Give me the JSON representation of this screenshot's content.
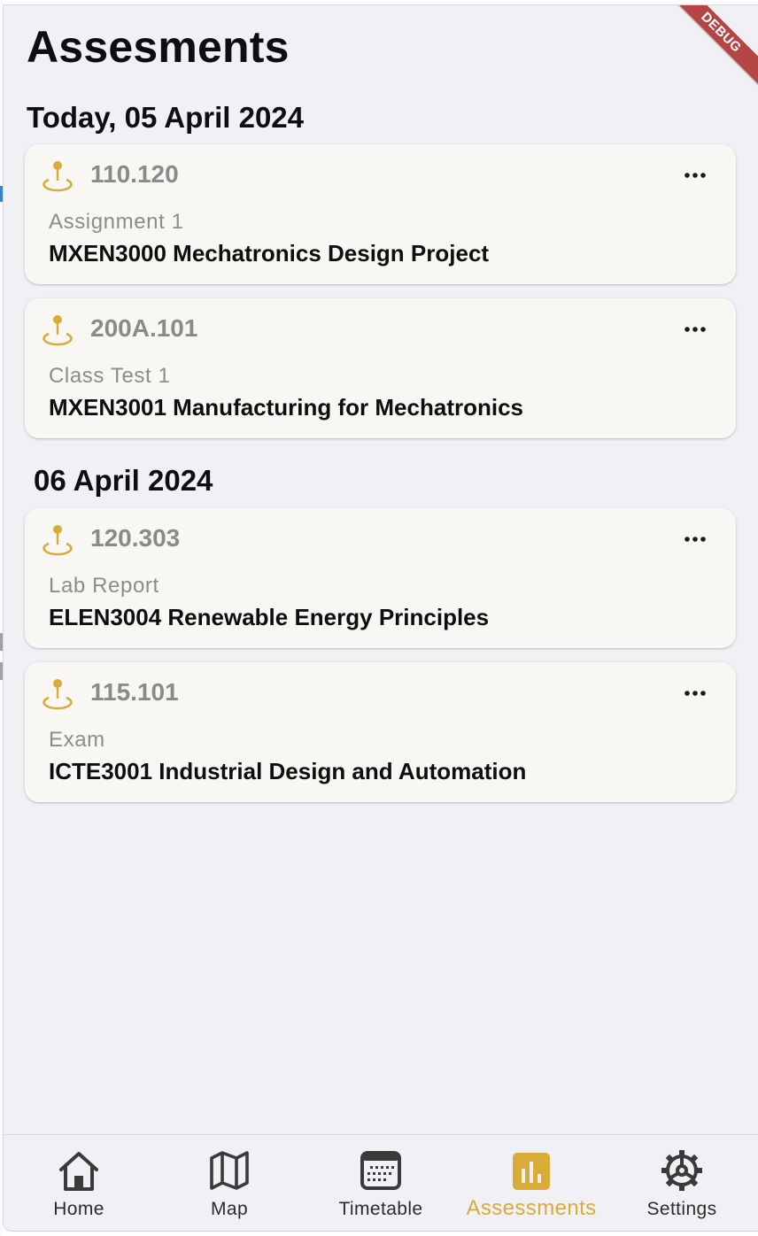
{
  "header": {
    "title": "Assesments",
    "debug_banner": "DEBUG"
  },
  "groups": [
    {
      "date": "Today, 05 April 2024",
      "items": [
        {
          "room": "110.120",
          "type": "Assignment 1",
          "course": "MXEN3000 Mechatronics Design Project"
        },
        {
          "room": "200A.101",
          "type": "Class Test 1",
          "course": "MXEN3001 Manufacturing for Mechatronics"
        }
      ]
    },
    {
      "date": "06 April 2024",
      "items": [
        {
          "room": "120.303",
          "type": "Lab Report",
          "course": "ELEN3004 Renewable Energy Principles"
        },
        {
          "room": "115.101",
          "type": "Exam",
          "course": "ICTE3001 Industrial Design and Automation"
        }
      ]
    }
  ],
  "nav": {
    "items": [
      {
        "label": "Home",
        "icon": "home-icon"
      },
      {
        "label": "Map",
        "icon": "map-icon"
      },
      {
        "label": "Timetable",
        "icon": "calendar-icon"
      },
      {
        "label": "Assessments",
        "icon": "bar-chart-icon"
      },
      {
        "label": "Settings",
        "icon": "gear-icon"
      }
    ],
    "active_index": 3
  },
  "colors": {
    "accent": "#d9ac3a",
    "background": "#f1f1f5",
    "card": "#f8f7f4",
    "debug": "#b54545"
  }
}
